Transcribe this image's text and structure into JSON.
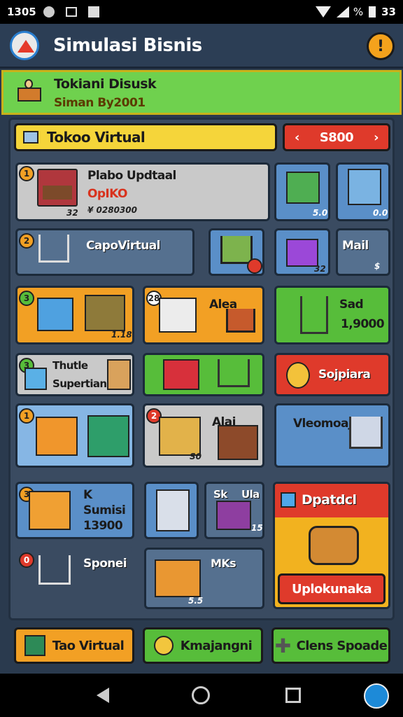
{
  "status_bar": {
    "time": "1305",
    "percent": "%",
    "battery": "33"
  },
  "app": {
    "title": "Simulasi Bisnis",
    "alert_icon": "!"
  },
  "banner": {
    "line1": "Tokiani Disusk",
    "line2": "Siman By2001"
  },
  "store": {
    "title": "Tokoo Virtual",
    "cash": "S800",
    "left": "‹",
    "right": "›"
  },
  "cards": {
    "c1": {
      "badge": "1",
      "title": "Plabo Updtaal",
      "sub": "OpIKO",
      "price": "¥ 0280300",
      "count": "32"
    },
    "c1b": {
      "count": "5.0"
    },
    "c1c": {
      "count": "0.0"
    },
    "c2": {
      "badge": "2",
      "title": "CapoVirtual"
    },
    "c2b": {
      "count": "Mail"
    },
    "c2c": {
      "count": "32",
      "corner": "$"
    },
    "c3": {
      "badge": "3",
      "count": "1.18"
    },
    "c4": {
      "badge": "28",
      "title": "Alea"
    },
    "c5": {
      "title": "Sad",
      "price": "1,9000"
    },
    "c6": {
      "badge": "3",
      "title1": "Thutle",
      "title2": "Supertian"
    },
    "c8": {
      "title": "Sojpiara"
    },
    "c9": {
      "badge": "1"
    },
    "c10": {
      "badge": "2",
      "title": "Alai",
      "count": "S0"
    },
    "c11": {
      "title": "Vleomoaj"
    },
    "c12": {
      "badge": "3",
      "t1": "K",
      "t2": "Sumisi",
      "t3": "13900"
    },
    "c13": {
      "count": ""
    },
    "c14": {
      "t1": "Sk",
      "t2": "Ula",
      "count": "15"
    },
    "c15": {
      "title": "Dpatdcl",
      "action": "Uplokunaka"
    },
    "c16": {
      "badge": "0",
      "title": "Sponei"
    },
    "c17": {
      "count": "5.5",
      "title": "MKs"
    }
  },
  "bottom": {
    "b1": "Tao Virtual",
    "b2": "Kmajangni",
    "b3": "Clens Spoade"
  },
  "colors": {
    "accent": "#f2a024",
    "green": "#57bd3a",
    "red": "#df3a2b",
    "board": "#3a4b61"
  }
}
